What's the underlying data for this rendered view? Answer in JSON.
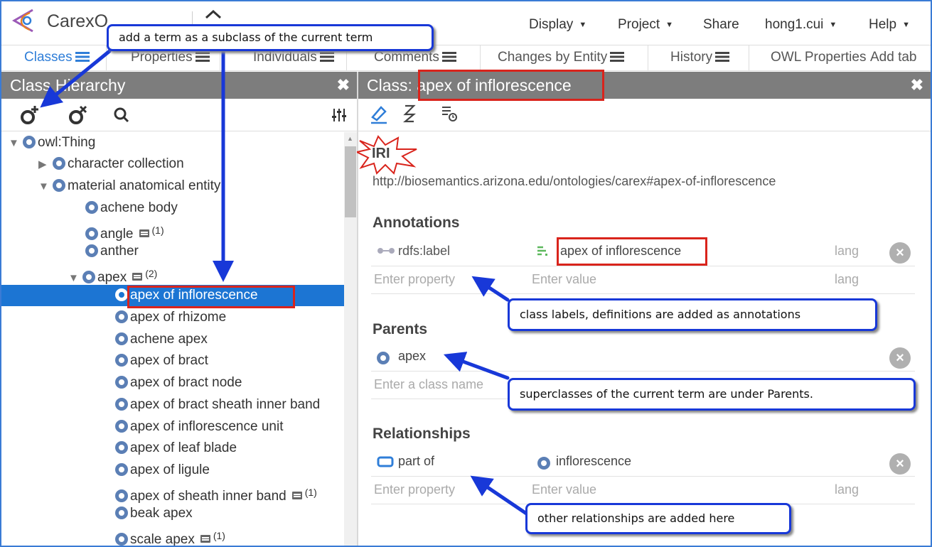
{
  "app": {
    "title": "CarexOntology",
    "visible_title": "CarexO"
  },
  "top_menu": [
    {
      "label": "Display"
    },
    {
      "label": "Project"
    },
    {
      "label": "Share"
    },
    {
      "label": "hong1.cui"
    },
    {
      "label": "Help"
    }
  ],
  "tabs": [
    {
      "label": "Classes"
    },
    {
      "label": "Properties"
    },
    {
      "label": "Individuals"
    },
    {
      "label": "Comments"
    },
    {
      "label": "Changes by Entity"
    },
    {
      "label": "History"
    },
    {
      "label": "OWL Properties"
    }
  ],
  "add_tab_label": "Add tab",
  "left_panel": {
    "title": "Class Hierarchy",
    "close": "✖"
  },
  "right_panel": {
    "title_prefix": "Class: ",
    "title_name": "apex of inflorescence",
    "close": "✖"
  },
  "tree": [
    {
      "label": "owl:Thing",
      "toggle": "▼"
    },
    {
      "label": "character collection",
      "toggle": "▶"
    },
    {
      "label": "material anatomical entity",
      "toggle": "▼"
    },
    {
      "label": "achene body"
    },
    {
      "label": "angle",
      "count": "(1)"
    },
    {
      "label": "anther"
    },
    {
      "label": "apex",
      "toggle": "▼",
      "count": "(2)"
    },
    {
      "label": "apex of inflorescence",
      "selected": true
    },
    {
      "label": "apex of rhizome"
    },
    {
      "label": "achene apex"
    },
    {
      "label": "apex of bract"
    },
    {
      "label": "apex of bract node"
    },
    {
      "label": "apex of bract sheath inner band"
    },
    {
      "label": "apex of inflorescence unit"
    },
    {
      "label": "apex of leaf blade"
    },
    {
      "label": "apex of ligule"
    },
    {
      "label": "apex of sheath inner band",
      "count": "(1)"
    },
    {
      "label": "beak apex"
    },
    {
      "label": "scale apex",
      "count": "(1)"
    }
  ],
  "iri": {
    "label": "IRI",
    "value": "http://biosemantics.arizona.edu/ontologies/carex#apex-of-inflorescence"
  },
  "annotations": {
    "title": "Annotations",
    "property": "rdfs:label",
    "value": "apex of inflorescence",
    "lang": "lang",
    "property_placeholder": "Enter property",
    "value_placeholder": "Enter value",
    "lang_placeholder": "lang"
  },
  "parents": {
    "title": "Parents",
    "value": "apex",
    "placeholder": "Enter a class name"
  },
  "relationships": {
    "title": "Relationships",
    "property": "part of",
    "value": "inflorescence",
    "property_placeholder": "Enter property",
    "value_placeholder": "Enter value",
    "lang_placeholder": "lang"
  },
  "callouts": {
    "subclass": "add a term as a subclass of the current term",
    "annotations": "class labels, definitions are added as annotations",
    "parents": "superclasses of the current term are under Parents.",
    "relationships": "other relationships are added  here"
  },
  "colors": {
    "accent_blue": "#1c75d3",
    "header_gray": "#7d7d7d",
    "callout_blue": "#1838d8",
    "highlight_red": "#d9241c"
  },
  "icons": [
    "carex-logo-icon",
    "home-icon",
    "add-subclass-icon",
    "delete-class-icon",
    "search-icon",
    "tree-options-icon",
    "edit-pencil-icon",
    "graph-icon",
    "changes-list-icon",
    "comment-icon",
    "class-icon",
    "annotation-property-icon",
    "object-property-icon",
    "remove-icon"
  ]
}
